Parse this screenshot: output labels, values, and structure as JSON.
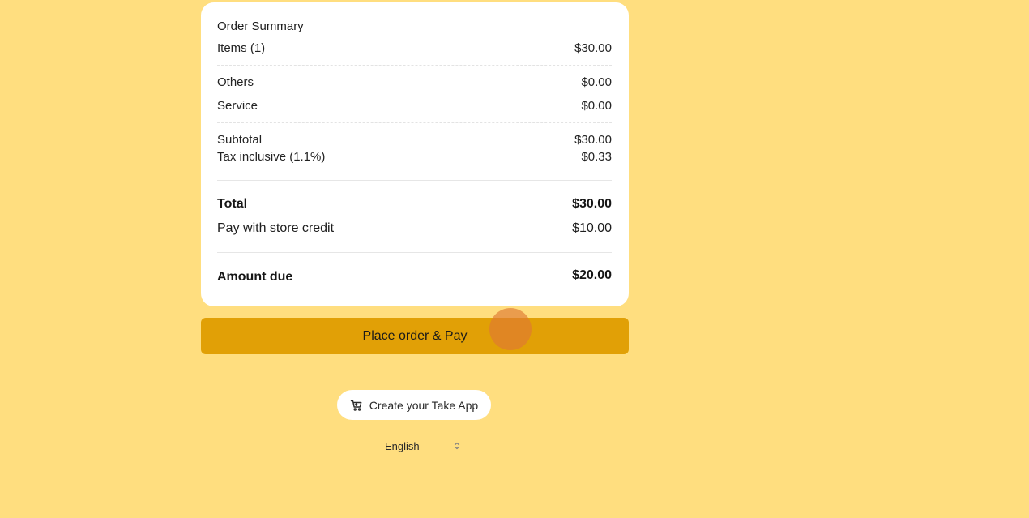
{
  "summary": {
    "title": "Order Summary",
    "items_label": "Items (1)",
    "items_value": "$30.00",
    "others_label": "Others",
    "others_value": "$0.00",
    "service_label": "Service",
    "service_value": "$0.00",
    "subtotal_label": "Subtotal",
    "subtotal_value": "$30.00",
    "tax_label": "Tax inclusive (1.1%)",
    "tax_value": "$0.33",
    "total_label": "Total",
    "total_value": "$30.00",
    "credit_label": "Pay with store credit",
    "credit_value": "$10.00",
    "due_label": "Amount due",
    "due_value": "$20.00"
  },
  "actions": {
    "pay_label": "Place order & Pay",
    "take_app_label": "Create your Take App",
    "take_app_icon": "cart-icon"
  },
  "language": {
    "selected": "English",
    "icon": "chevron-updown-icon"
  },
  "colors": {
    "background": "#ffde7f",
    "button": "#e1a006",
    "card": "#ffffff"
  }
}
